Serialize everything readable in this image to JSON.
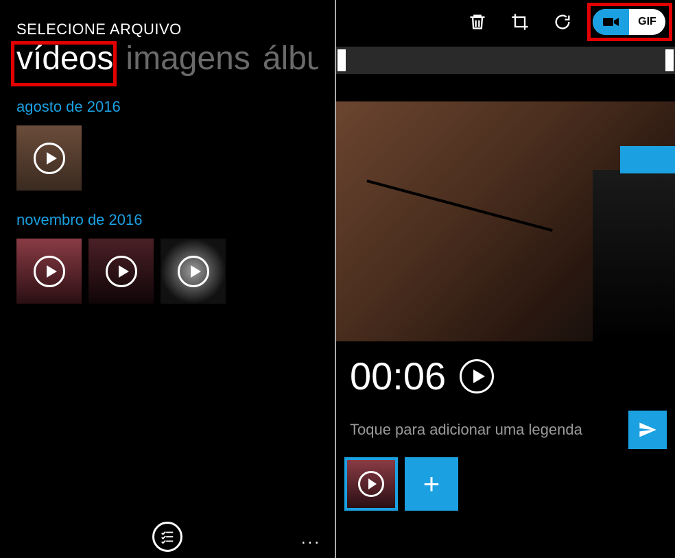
{
  "left": {
    "header_label": "SELECIONE ARQUIVO",
    "tabs": {
      "videos": "vídeos",
      "images": "imagens",
      "albums": "álbu"
    },
    "groups": [
      {
        "date": "agosto de 2016",
        "count": 1
      },
      {
        "date": "novembro de 2016",
        "count": 3
      }
    ],
    "ellipsis": "..."
  },
  "right": {
    "toggle_gif_label": "GIF",
    "video_time": "00:06",
    "caption_placeholder": "Toque para adicionar uma legenda",
    "add_label": "+"
  },
  "colors": {
    "accent": "#1ba1e2",
    "highlight": "#e20000"
  }
}
